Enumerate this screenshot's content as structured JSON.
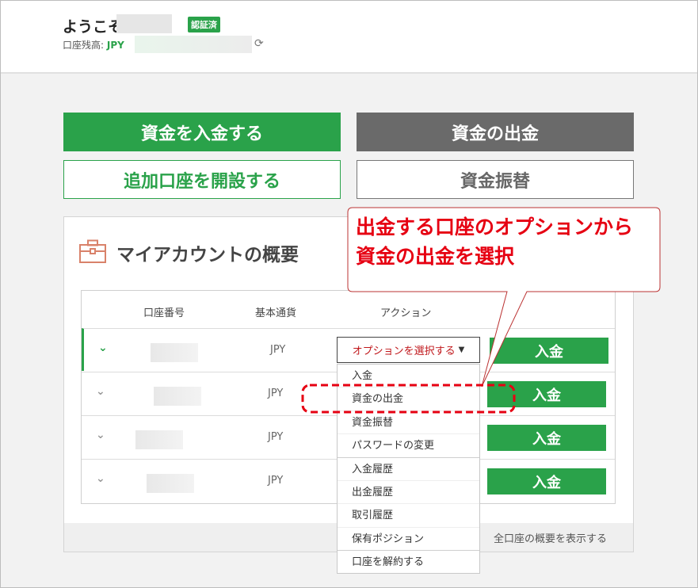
{
  "header": {
    "welcome": "ようこそ",
    "verified_badge": "認証済",
    "balance_label": "口座残高: ",
    "balance_currency": "JPY"
  },
  "actions": {
    "deposit": "資金を入金する",
    "withdraw": "資金の出金",
    "open_account": "追加口座を開設する",
    "transfer": "資金振替"
  },
  "overview": {
    "title": "マイアカウントの概要",
    "columns": [
      "口座番号",
      "基本通貨",
      "アクション"
    ],
    "rows": [
      {
        "currency": "JPY",
        "button": "入金"
      },
      {
        "currency": "JPY",
        "button": "入金"
      },
      {
        "currency": "JPY",
        "button": "入金"
      },
      {
        "currency": "JPY",
        "button": "入金"
      }
    ],
    "show_all": "全口座の概要を表示する"
  },
  "dropdown": {
    "selected": "オプションを選択する",
    "items": [
      "入金",
      "資金の出金",
      "資金振替",
      "パスワードの変更",
      "入金履歴",
      "出金履歴",
      "取引履歴",
      "保有ポジション",
      "口座を解約する"
    ]
  },
  "callout": {
    "line1": "出金する口座のオプションから",
    "line2": "資金の出金を選択"
  },
  "colors": {
    "brand": "#2aa24a",
    "callout": "#e60012",
    "gray_button": "#6a6a6a"
  }
}
